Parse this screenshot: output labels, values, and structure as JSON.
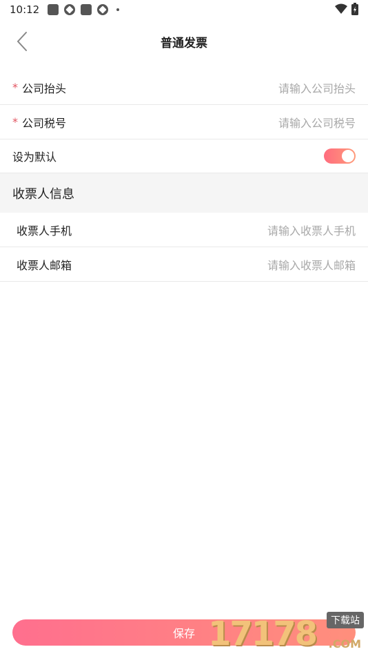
{
  "status_bar": {
    "time": "10:12"
  },
  "nav": {
    "title": "普通发票"
  },
  "form": {
    "company_title": {
      "required_mark": "*",
      "label": "公司抬头",
      "placeholder": "请输入公司抬头"
    },
    "tax_number": {
      "required_mark": "*",
      "label": "公司税号",
      "placeholder": "请输入公司税号"
    },
    "default": {
      "label": "设为默认",
      "checked": true
    }
  },
  "receiver": {
    "section_title": "收票人信息",
    "phone": {
      "label": "收票人手机",
      "placeholder": "请输入收票人手机"
    },
    "email": {
      "label": "收票人邮箱",
      "placeholder": "请输入收票人邮箱"
    }
  },
  "save_label": "保存",
  "watermark": {
    "number": "17178",
    "tag": "下载站",
    "domain": ".COM"
  },
  "colors": {
    "accent_start": "#ff6f8e",
    "accent_end": "#ff8f7c",
    "required": "#e25561"
  }
}
